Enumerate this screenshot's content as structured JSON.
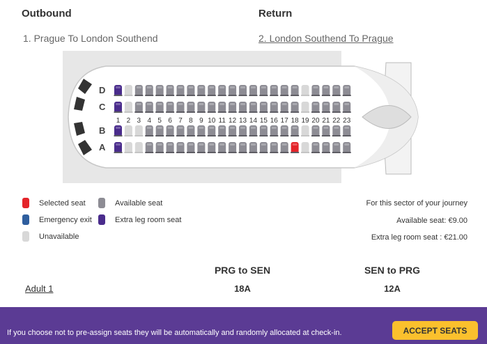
{
  "outbound": {
    "title": "Outbound",
    "route": "1.  Prague To London Southend"
  },
  "return": {
    "title": "Return",
    "route": "2.  London Southend To Prague"
  },
  "seatmap": {
    "rows": [
      "D",
      "C",
      "B",
      "A"
    ],
    "columns": [
      "1",
      "2",
      "3",
      "4",
      "5",
      "6",
      "7",
      "8",
      "9",
      "10",
      "11",
      "12",
      "13",
      "14",
      "15",
      "16",
      "17",
      "18",
      "19",
      "20",
      "21",
      "22",
      "23"
    ],
    "colors": {
      "available": "#8d8c94",
      "available_light": "#b6b5bc",
      "selected": "#e4242a",
      "extra_leg": "#4a2c8c",
      "unavailable": "#d8d8d8",
      "emergency": "#2f5e9e"
    },
    "grid": {
      "D": [
        "x",
        "u",
        "a",
        "a",
        "a",
        "a",
        "a",
        "a",
        "a",
        "a",
        "a",
        "a",
        "a",
        "a",
        "a",
        "a",
        "a",
        "a",
        "u",
        "a",
        "a",
        "a",
        "a"
      ],
      "C": [
        "x",
        "u",
        "a",
        "a",
        "a",
        "a",
        "a",
        "a",
        "a",
        "a",
        "a",
        "a",
        "a",
        "a",
        "a",
        "a",
        "a",
        "a",
        "u",
        "a",
        "a",
        "a",
        "a"
      ],
      "B": [
        "x",
        "u",
        "u",
        "a",
        "a",
        "a",
        "a",
        "a",
        "a",
        "a",
        "a",
        "a",
        "a",
        "a",
        "a",
        "a",
        "a",
        "a",
        "u",
        "a",
        "a",
        "a",
        "a"
      ],
      "A": [
        "x",
        "u",
        "u",
        "a",
        "a",
        "a",
        "a",
        "a",
        "a",
        "a",
        "a",
        "a",
        "a",
        "a",
        "a",
        "a",
        "a",
        "s",
        "u",
        "a",
        "a",
        "a",
        "a"
      ]
    }
  },
  "legend": {
    "selected": "Selected seat",
    "available": "Available seat",
    "emergency": "Emergency exit",
    "extra_leg": "Extra leg room seat",
    "unavailable": "Unavailable"
  },
  "prices": {
    "heading": "For this sector of your journey",
    "available": "Available seat: €9.00",
    "extra": "Extra leg room seat : €21.00"
  },
  "summary": {
    "columns": [
      "PRG to SEN",
      "SEN to PRG"
    ],
    "passenger": "Adult 1",
    "seats": [
      "18A",
      "12A"
    ]
  },
  "footer": {
    "notice": "If you choose not to pre-assign seats they will be automatically and randomly allocated at check-in.",
    "accept_label": "ACCEPT SEATS"
  }
}
